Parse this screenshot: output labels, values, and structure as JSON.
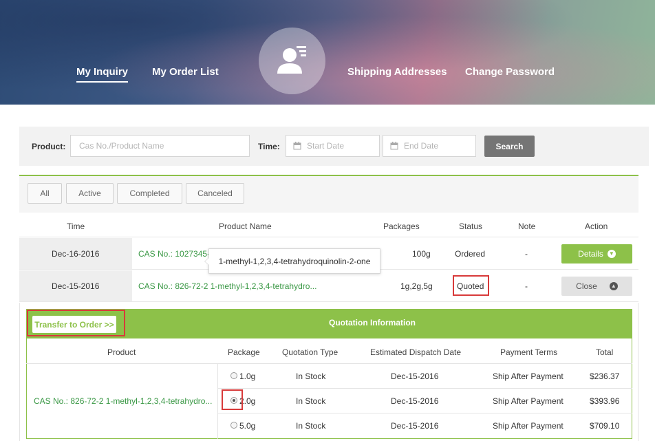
{
  "nav": {
    "inquiry": "My Inquiry",
    "orders": "My Order List",
    "addresses": "Shipping Addresses",
    "password": "Change Password"
  },
  "search": {
    "product_label": "Product:",
    "product_placeholder": "Cas No./Product Name",
    "time_label": "Time:",
    "start_placeholder": "Start Date",
    "end_placeholder": "End Date",
    "button": "Search"
  },
  "filters": [
    "All",
    "Active",
    "Completed",
    "Canceled"
  ],
  "table": {
    "headers": [
      "Time",
      "Product Name",
      "Packages",
      "Status",
      "Note",
      "Action"
    ],
    "rows": [
      {
        "time": "Dec-16-2016",
        "product": "CAS No.: 1027345-",
        "packages": "100g",
        "status": "Ordered",
        "note": "-",
        "action": "Details"
      },
      {
        "time": "Dec-15-2016",
        "product": "CAS No.: 826-72-2 1-methyl-1,2,3,4-tetrahydro...",
        "packages": "1g,2g,5g",
        "status": "Quoted",
        "note": "-",
        "action": "Close"
      }
    ],
    "tooltip": "1-methyl-1,2,3,4-tetrahydroquinolin-2-one"
  },
  "quote": {
    "transfer": "Transfer to Order >>",
    "title": "Quotation Information",
    "headers": [
      "Product",
      "Package",
      "Quotation Type",
      "Estimated Dispatch Date",
      "Payment Terms",
      "Total"
    ],
    "product": "CAS No.: 826-72-2 1-methyl-1,2,3,4-tetrahydro...",
    "rows": [
      {
        "package": "1.0g",
        "type": "In Stock",
        "date": "Dec-15-2016",
        "terms": "Ship After Payment",
        "total": "$236.37",
        "selected": false
      },
      {
        "package": "2.0g",
        "type": "In Stock",
        "date": "Dec-15-2016",
        "terms": "Ship After Payment",
        "total": "$393.96",
        "selected": true
      },
      {
        "package": "5.0g",
        "type": "In Stock",
        "date": "Dec-15-2016",
        "terms": "Ship After Payment",
        "total": "$709.10",
        "selected": false
      }
    ]
  },
  "colors": {
    "accent": "#8dc149",
    "link": "#3a9845",
    "highlight": "#d83a3a"
  }
}
